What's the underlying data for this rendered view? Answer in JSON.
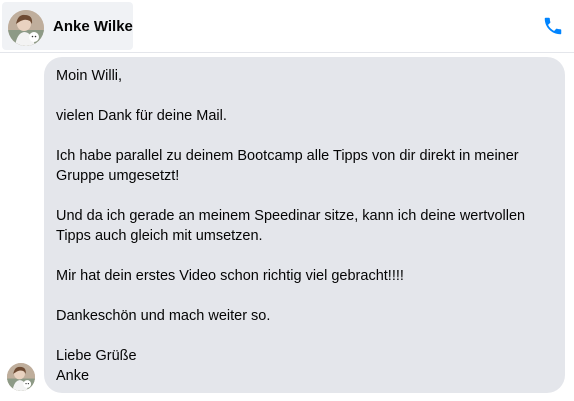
{
  "conversation": {
    "contact_name": "Anke Wilke",
    "call_icon": "phone-icon",
    "accent_color": "#0084ff"
  },
  "message": {
    "bubble_color": "#e4e6eb",
    "lines": [
      "Moin Willi,",
      "vielen Dank für deine Mail.",
      "Ich habe parallel zu deinem Bootcamp alle Tipps von dir direkt in meiner",
      "Gruppe umgesetzt!",
      "Und da ich gerade an meinem Speedinar sitze, kann ich deine wertvollen",
      "Tipps auch gleich mit umsetzen.",
      "Mir hat dein erstes Video schon richtig viel gebracht!!!!",
      "Dankeschön und mach weiter so.",
      "Liebe Grüße",
      "Anke"
    ]
  }
}
